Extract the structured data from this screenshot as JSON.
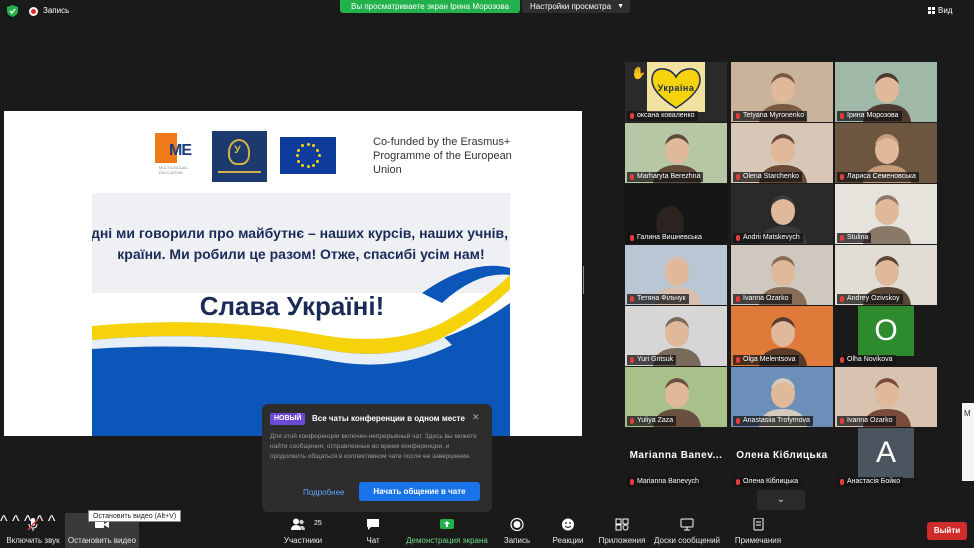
{
  "topbar": {
    "recording_label": "Запись",
    "share_banner": "Вы просматриваете экран Ірина Морозова",
    "view_settings": "Настройки просмотра",
    "view_label": "Вид"
  },
  "slide": {
    "me_logo_text": "ME",
    "me_logo_sub": "MULTILINGUAL EDUCATION",
    "eu_text": "Co-funded by the Erasmus+ Programme of the European Union",
    "message": "Сьогодні ми говорили про майбутнє – наших курсів, наших учнів, нашої країни. Ми робили це разом! Отже, спасибі усім нам!",
    "glory": "Слава Україні!",
    "colors": {
      "navy": "#1b2b57",
      "blue": "#0b56b8",
      "yellow": "#f5d20a"
    }
  },
  "chat_popup": {
    "badge": "НОВЫЙ",
    "title": "Все чаты конференции в одном месте",
    "body": "Для этой конференции включен непрерывный чат. Здесь вы можете найти сообщения, отправленные во время конференции, и продолжить общаться в коллективном чате после ее завершения.",
    "more_link": "Подробнее",
    "start_button": "Начать общение в чате"
  },
  "participants": [
    {
      "name": "оксана коваленко",
      "kind": "heart",
      "heart_text": "Україна"
    },
    {
      "name": "Tetyana Myronenko",
      "kind": "photo"
    },
    {
      "name": "Ірина Морозова",
      "kind": "photo",
      "active": true
    },
    {
      "name": "Marharyta Berezhna",
      "kind": "photo"
    },
    {
      "name": "Olena Starchenko",
      "kind": "photo"
    },
    {
      "name": "Лариса Семеновська",
      "kind": "photo"
    },
    {
      "name": "Галина Вишневська",
      "kind": "dark"
    },
    {
      "name": "Andrii Matskevych",
      "kind": "photo"
    },
    {
      "name": "Stulina",
      "kind": "photo"
    },
    {
      "name": "Тетяна Фільчук",
      "kind": "photo"
    },
    {
      "name": "Ivanna Ozarko",
      "kind": "photo"
    },
    {
      "name": "Andrey Ozivskoy",
      "kind": "photo"
    },
    {
      "name": "Yuri Gritsuk",
      "kind": "photo"
    },
    {
      "name": "Olga Melentsova",
      "kind": "photo"
    },
    {
      "name": "Olha Novikova",
      "kind": "letter",
      "letter": "O",
      "letter_color": "#2d8a2d"
    },
    {
      "name": "Yuliya Zaza",
      "kind": "photo"
    },
    {
      "name": "Anastasiia Trofymova",
      "kind": "photo"
    },
    {
      "name": "Ivanna Ozarko",
      "kind": "photo"
    },
    {
      "name": "Marianna Banevych",
      "kind": "text",
      "big_name": "Marianna Banev..."
    },
    {
      "name": "Олена Кіблицька",
      "kind": "text",
      "big_name": "Олена Кіблицька"
    },
    {
      "name": "Анастасія Бойко",
      "kind": "letter",
      "letter": "A",
      "letter_color": "#4a5560"
    }
  ],
  "toolbar": {
    "unmute": "Включить звук",
    "stop_video": "Остановить видео",
    "tooltip": "Остановить видео (Alt+V)",
    "participants": "Участники",
    "participants_count": "25",
    "chat": "Чат",
    "share": "Демонстрация экрана",
    "record": "Запись",
    "reactions": "Реакции",
    "apps": "Приложения",
    "whiteboards": "Доски сообщений",
    "notes": "Примечания",
    "leave": "Выйти"
  },
  "side_tip": "М"
}
